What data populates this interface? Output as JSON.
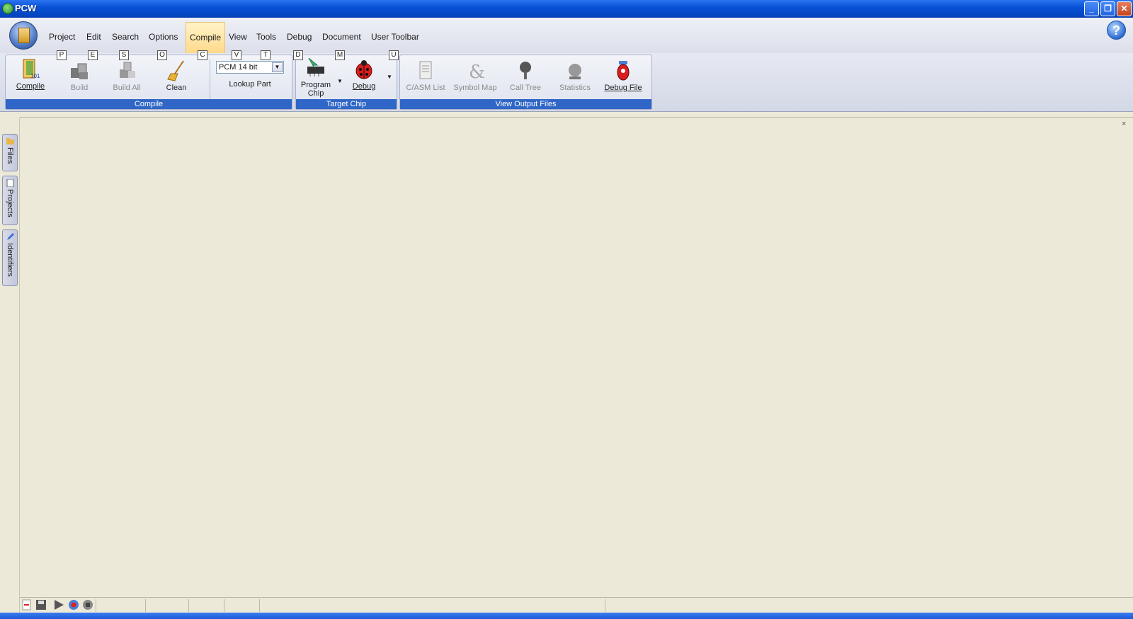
{
  "window": {
    "title": "PCW",
    "controls": {
      "minimize": "_",
      "restore": "❐",
      "close": "✕"
    }
  },
  "menu": {
    "items": [
      {
        "label": "Project",
        "keytip": "P"
      },
      {
        "label": "Edit",
        "keytip": "E"
      },
      {
        "label": "Search",
        "keytip": "S"
      },
      {
        "label": "Options",
        "keytip": "O"
      },
      {
        "label": "Compile",
        "keytip": "C",
        "active": true
      },
      {
        "label": "View",
        "keytip": "V"
      },
      {
        "label": "Tools",
        "keytip": "T"
      },
      {
        "label": "Debug",
        "keytip": "D"
      },
      {
        "label": "Document",
        "keytip": "M"
      },
      {
        "label": "User Toolbar",
        "keytip": "U"
      }
    ],
    "help": "?"
  },
  "ribbon": {
    "groups": {
      "compile": {
        "label": "Compile",
        "buttons": {
          "compile": {
            "label": "Compile",
            "enabled": true
          },
          "build": {
            "label": "Build",
            "enabled": false
          },
          "build_all": {
            "label": "Build All",
            "enabled": false
          },
          "clean": {
            "label": "Clean",
            "enabled": true
          }
        },
        "compiler_select": {
          "value": "PCM 14 bit"
        },
        "lookup_part": "Lookup Part"
      },
      "target_chip": {
        "label": "Target Chip",
        "buttons": {
          "program_chip": {
            "label_line1": "Program",
            "label_line2": "Chip"
          },
          "debug": {
            "label": "Debug"
          }
        }
      },
      "view_output": {
        "label": "View Output Files",
        "buttons": {
          "casm_list": {
            "label": "C/ASM List",
            "enabled": false
          },
          "symbol_map": {
            "label": "Symbol Map",
            "enabled": false
          },
          "call_tree": {
            "label": "Call Tree",
            "enabled": false
          },
          "statistics": {
            "label": "Statistics",
            "enabled": false
          },
          "debug_file": {
            "label": "Debug File",
            "enabled": true
          }
        }
      }
    }
  },
  "sidebar": {
    "tabs": [
      {
        "label": "Files",
        "icon": "folder-icon"
      },
      {
        "label": "Projects",
        "icon": "document-icon"
      },
      {
        "label": "Identifiers",
        "icon": "pencil-icon"
      }
    ]
  },
  "workspace": {
    "close_glyph": "×"
  },
  "macro_bar": {
    "buttons": [
      "new-macro-icon",
      "save-macro-icon",
      "play-macro-icon",
      "record-macro-icon",
      "stop-macro-icon"
    ]
  },
  "colors": {
    "titlebar": "#0a52d8",
    "group_label": "#2f66c7",
    "workspace": "#ece9d8",
    "active_tab": "#ffd98a"
  }
}
